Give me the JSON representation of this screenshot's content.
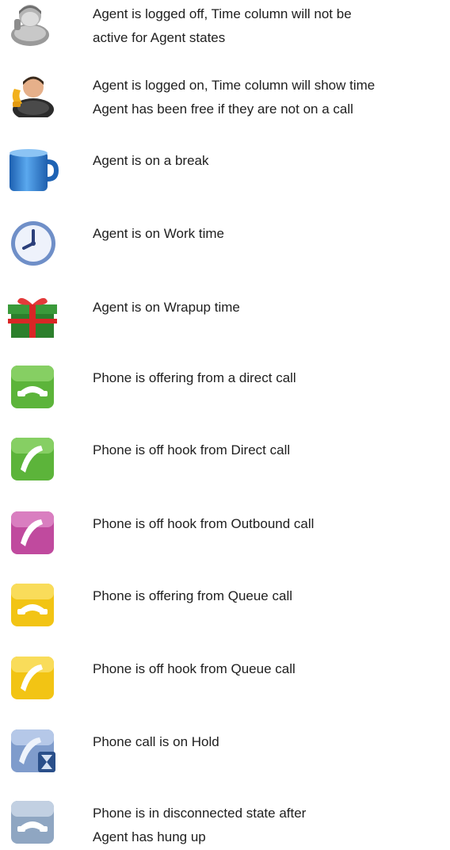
{
  "legend": {
    "items": [
      {
        "icon": "agent-logged-off-icon",
        "lines": [
          "Agent is logged off, Time column will not be",
          "active for Agent states"
        ]
      },
      {
        "icon": "agent-logged-on-icon",
        "lines": [
          "Agent is logged on, Time column will show time",
          "Agent has been free if they are not on a call"
        ]
      },
      {
        "icon": "break-cup-icon",
        "lines": [
          "Agent is on a break"
        ]
      },
      {
        "icon": "work-clock-icon",
        "lines": [
          "Agent is on Work time"
        ]
      },
      {
        "icon": "wrapup-gift-icon",
        "lines": [
          "Agent is on Wrapup time"
        ]
      },
      {
        "icon": "direct-offering-phone-icon",
        "lines": [
          "Phone is offering from a direct call"
        ]
      },
      {
        "icon": "direct-offhook-phone-icon",
        "lines": [
          "Phone is off hook from Direct call"
        ]
      },
      {
        "icon": "outbound-offhook-phone-icon",
        "lines": [
          "Phone is off hook from Outbound call"
        ]
      },
      {
        "icon": "queue-offering-phone-icon",
        "lines": [
          "Phone is offering from Queue call"
        ]
      },
      {
        "icon": "queue-offhook-phone-icon",
        "lines": [
          "Phone is off hook from Queue call"
        ]
      },
      {
        "icon": "hold-phone-icon",
        "lines": [
          "Phone call is on Hold"
        ]
      },
      {
        "icon": "disconnected-phone-icon",
        "lines": [
          "Phone is in disconnected state after",
          "Agent has hung up"
        ]
      }
    ]
  },
  "colors": {
    "green": "#5cb43a",
    "magenta": "#c04a9e",
    "yellow": "#f2c414",
    "blue": "#2f7fd0",
    "steel": "#8fa6c2"
  }
}
